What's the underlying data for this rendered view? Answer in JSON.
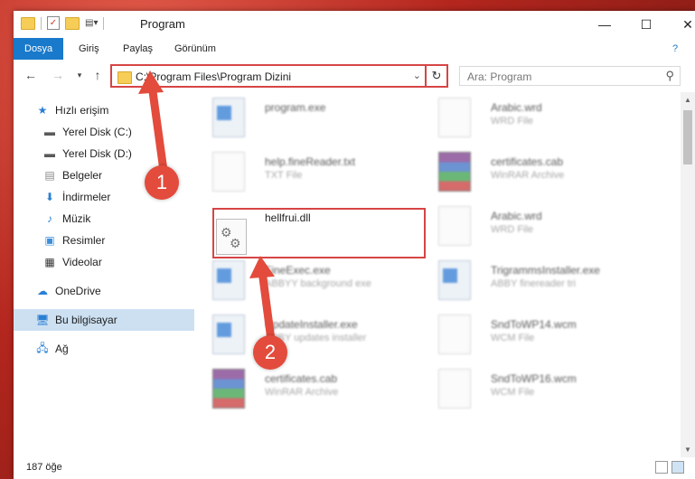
{
  "window": {
    "title": "Program",
    "controls": {
      "minimize": "—",
      "maximize": "☐",
      "close": "✕"
    }
  },
  "ribbon": {
    "tabs": [
      {
        "label": "Dosya"
      },
      {
        "label": "Giriş"
      },
      {
        "label": "Paylaş"
      },
      {
        "label": "Görünüm"
      }
    ],
    "help": "?"
  },
  "address": {
    "path": "C:\\Program Files\\Program Dizini",
    "search_placeholder": "Ara: Program"
  },
  "nav": {
    "items": [
      {
        "label": "Hızlı erişim",
        "icon": "star-icon",
        "pinned": false
      },
      {
        "label": "Yerel Disk (C:)",
        "icon": "drive-icon",
        "pinned": true
      },
      {
        "label": "Yerel Disk (D:)",
        "icon": "drive-icon",
        "pinned": true
      },
      {
        "label": "Belgeler",
        "icon": "documents-icon",
        "pinned": true
      },
      {
        "label": "İndirmeler",
        "icon": "download-icon",
        "pinned": true
      },
      {
        "label": "Müzik",
        "icon": "music-icon",
        "pinned": true
      },
      {
        "label": "Resimler",
        "icon": "pictures-icon",
        "pinned": true
      },
      {
        "label": "Videolar",
        "icon": "videos-icon",
        "pinned": true
      },
      {
        "label": "OneDrive",
        "icon": "cloud-icon",
        "pinned": false
      },
      {
        "label": "Bu bilgisayar",
        "icon": "computer-icon",
        "pinned": false
      },
      {
        "label": "Ağ",
        "icon": "network-icon",
        "pinned": false
      }
    ]
  },
  "files": [
    {
      "name": "program.exe",
      "type": "",
      "kind": "exe"
    },
    {
      "name": "Arabic.wrd",
      "type": "WRD File",
      "kind": "doc"
    },
    {
      "name": "help.fineReader.txt",
      "type": "TXT File",
      "kind": "doc"
    },
    {
      "name": "certificates.cab",
      "type": "WinRAR Archive",
      "kind": "rar"
    },
    {
      "name": "hellfrui.dll",
      "type": "",
      "kind": "dll"
    },
    {
      "name": "Arabic.wrd",
      "type": "WRD File",
      "kind": "doc"
    },
    {
      "name": "FineExec.exe",
      "type": "ABBYY background exe",
      "kind": "exe"
    },
    {
      "name": "TrigrammsInstaller.exe",
      "type": "ABBY finereader tri",
      "kind": "exe"
    },
    {
      "name": "UpdateInstaller.exe",
      "type": "ABBY updates installer",
      "kind": "exe"
    },
    {
      "name": "SndToWP14.wcm",
      "type": "WCM File",
      "kind": "doc"
    },
    {
      "name": "certificates.cab",
      "type": "WinRAR Archive",
      "kind": "rar"
    },
    {
      "name": "SndToWP16.wcm",
      "type": "WCM File",
      "kind": "doc"
    }
  ],
  "status": {
    "count": "187 öğe"
  },
  "markers": {
    "one": "1",
    "two": "2"
  },
  "colors": {
    "accent": "#1979ca",
    "highlight": "#d64545",
    "marker": "#e34b3c"
  }
}
